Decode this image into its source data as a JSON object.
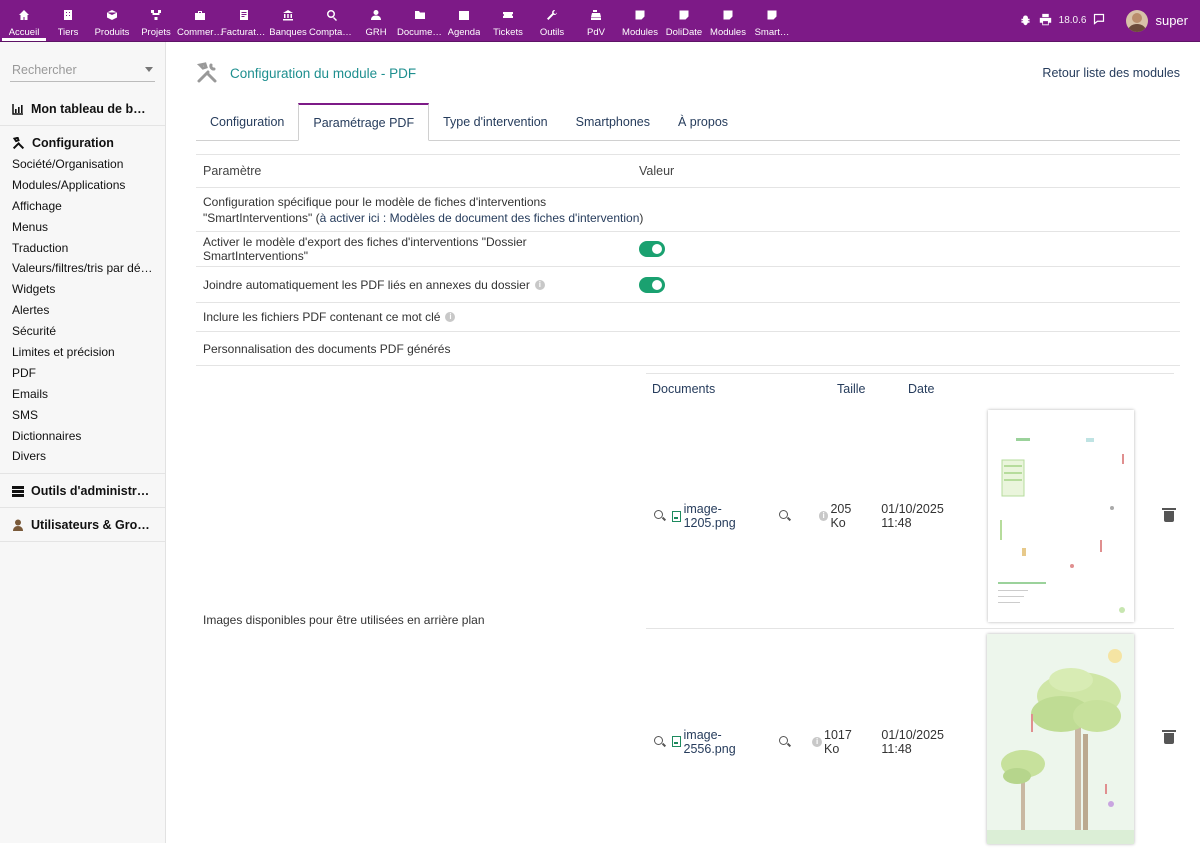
{
  "topnav": [
    {
      "label": "Accueil",
      "icon": "home-icon",
      "active": true
    },
    {
      "label": "Tiers",
      "icon": "building-icon"
    },
    {
      "label": "Produits",
      "icon": "cube-icon"
    },
    {
      "label": "Projets",
      "icon": "project-icon"
    },
    {
      "label": "Commerce",
      "icon": "briefcase-icon"
    },
    {
      "label": "Facturation",
      "icon": "invoice-icon"
    },
    {
      "label": "Banques",
      "icon": "bank-icon"
    },
    {
      "label": "Comptabilité",
      "icon": "search-dollar-icon"
    },
    {
      "label": "GRH",
      "icon": "user-tie-icon"
    },
    {
      "label": "Documents",
      "icon": "folder-icon"
    },
    {
      "label": "Agenda",
      "icon": "calendar-icon"
    },
    {
      "label": "Tickets",
      "icon": "ticket-icon"
    },
    {
      "label": "Outils",
      "icon": "wrench-icon"
    },
    {
      "label": "PdV",
      "icon": "cash-register-icon"
    },
    {
      "label": "Modules",
      "icon": "note-icon"
    },
    {
      "label": "DoliDate",
      "icon": "note-icon"
    },
    {
      "label": "Modules",
      "icon": "note-icon"
    },
    {
      "label": "Smart…",
      "icon": "note-icon"
    }
  ],
  "topright": {
    "version": "18.0.6",
    "user": "super"
  },
  "sidebar": {
    "search_placeholder": "Rechercher",
    "dashboard": "Mon tableau de bord",
    "config_title": "Configuration",
    "config_items": [
      "Société/Organisation",
      "Modules/Applications",
      "Affichage",
      "Menus",
      "Traduction",
      "Valeurs/filtres/tris par défaut",
      "Widgets",
      "Alertes",
      "Sécurité",
      "Limites et précision",
      "PDF",
      "Emails",
      "SMS",
      "Dictionnaires",
      "Divers"
    ],
    "admin_tools": "Outils d'administration",
    "users_groups": "Utilisateurs & Groupes"
  },
  "page": {
    "title": "Configuration du module - PDF",
    "back_link": "Retour liste des modules"
  },
  "tabs": [
    "Configuration",
    "Paramétrage PDF",
    "Type d'intervention",
    "Smartphones",
    "À propos"
  ],
  "table": {
    "col_param": "Paramètre",
    "col_value": "Valeur",
    "rows": {
      "specific_line1": "Configuration spécifique pour le modèle de fiches d'interventions",
      "specific_line2": "\"SmartInterventions\"",
      "specific_paren_open": " (",
      "specific_link": "à activer ici : Modèles de document des fiches d'intervention",
      "specific_paren_close": ")",
      "activate_export": "Activer le modèle d'export des fiches d'interventions \"Dossier SmartInterventions\"",
      "attach_pdf": "Joindre automatiquement les PDF liés en annexes du dossier",
      "include_keyword": "Inclure les fichiers PDF contenant ce mot clé",
      "personalize": "Personnalisation des documents PDF générés",
      "background_images": "Images disponibles pour être utilisées en arrière plan"
    },
    "toggles": {
      "activate_export": true,
      "attach_pdf": true
    }
  },
  "documents": {
    "headers": {
      "documents": "Documents",
      "size": "Taille",
      "date": "Date"
    },
    "files": [
      {
        "name": "image-1205.png",
        "size": "205 Ko",
        "date": "01/10/2025 11:48"
      },
      {
        "name": "image-2556.png",
        "size": "1017 Ko",
        "date": "01/10/2025 11:48"
      }
    ]
  },
  "colors": {
    "brand": "#7d1a87",
    "title": "#1e8f8f",
    "link": "#263c5c",
    "toggle_on": "#1aa170"
  }
}
